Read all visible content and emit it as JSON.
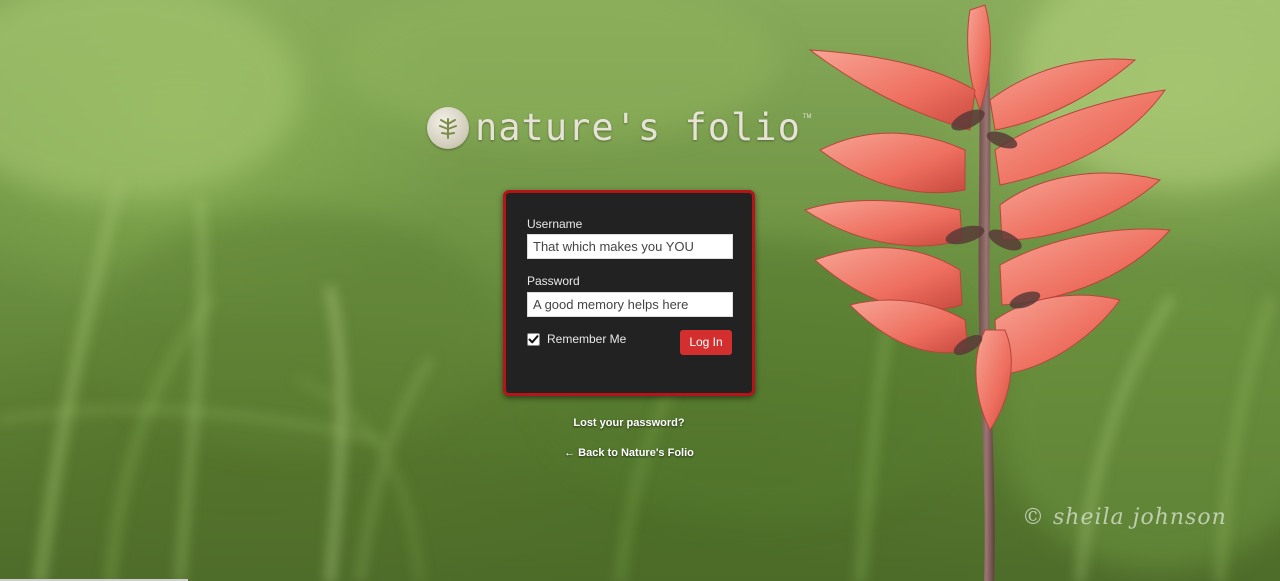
{
  "brand": {
    "logo_text": "nature's folio",
    "trademark": "TM"
  },
  "login_form": {
    "username_label": "Username",
    "username_placeholder": "That which makes you YOU",
    "password_label": "Password",
    "password_placeholder": "A good memory helps here",
    "remember_label": "Remember Me",
    "remember_checked": true,
    "submit_label": "Log In"
  },
  "links": {
    "lost_password": "Lost your password?",
    "back_to_site": "← Back to Nature's Folio"
  },
  "watermark": "© sheila johnson",
  "colors": {
    "box_background": "#222222",
    "box_border": "#b4141a",
    "button": "#d32f2f",
    "background_green": "#6f9444",
    "flower_coral": "#f07a6a"
  }
}
